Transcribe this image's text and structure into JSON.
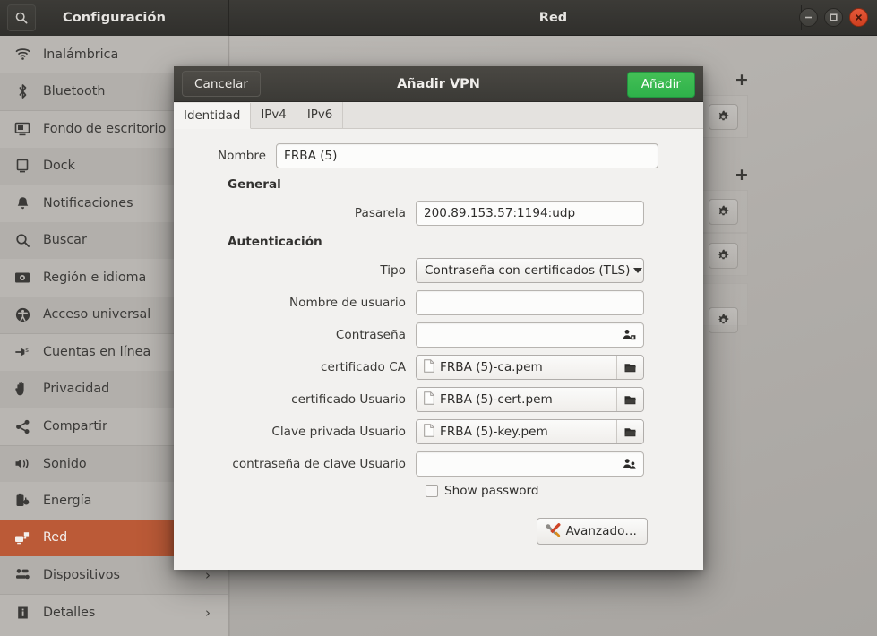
{
  "window": {
    "sidebar_title": "Configuración",
    "content_title": "Red",
    "search_icon": "search-icon",
    "controls": {
      "minimize": "minimize-icon",
      "maximize": "maximize-icon",
      "close": "close-icon"
    }
  },
  "sidebar": {
    "items": [
      {
        "label": "Inalámbrica",
        "icon": "wifi-icon"
      },
      {
        "label": "Bluetooth",
        "icon": "bluetooth-icon"
      },
      {
        "label": "Fondo de escritorio",
        "icon": "desktop-background-icon"
      },
      {
        "label": "Dock",
        "icon": "dock-icon"
      },
      {
        "label": "Notificaciones",
        "icon": "bell-icon"
      },
      {
        "label": "Buscar",
        "icon": "search-icon"
      },
      {
        "label": "Región e idioma",
        "icon": "region-language-icon"
      },
      {
        "label": "Acceso universal",
        "icon": "accessibility-icon"
      },
      {
        "label": "Cuentas en línea",
        "icon": "online-accounts-icon"
      },
      {
        "label": "Privacidad",
        "icon": "hand-privacy-icon"
      },
      {
        "label": "Compartir",
        "icon": "share-icon"
      },
      {
        "label": "Sonido",
        "icon": "sound-icon"
      },
      {
        "label": "Energía",
        "icon": "power-battery-icon"
      },
      {
        "label": "Red",
        "icon": "network-icon",
        "selected": true
      },
      {
        "label": "Dispositivos",
        "icon": "devices-icon",
        "arrow": "›"
      },
      {
        "label": "Detalles",
        "icon": "info-icon",
        "arrow": "›"
      }
    ]
  },
  "content": {
    "add_symbol": "+",
    "gear_icon": "gear-icon"
  },
  "dialog": {
    "title": "Añadir VPN",
    "cancel_label": "Cancelar",
    "add_label": "Añadir",
    "tabs": [
      {
        "label": "Identidad",
        "active": true
      },
      {
        "label": "IPv4",
        "active": false
      },
      {
        "label": "IPv6",
        "active": false
      }
    ],
    "fields": {
      "name_label": "Nombre",
      "name_value": "FRBA (5)",
      "general_heading": "General",
      "gateway_label": "Pasarela",
      "gateway_value": "200.89.153.57:1194:udp",
      "auth_heading": "Autenticación",
      "type_label": "Tipo",
      "type_value": "Contraseña con certificados (TLS)",
      "username_label": "Nombre de usuario",
      "username_value": "",
      "password_label": "Contraseña",
      "password_value": "",
      "ca_cert_label": "certificado CA",
      "ca_cert_value": "FRBA (5)-ca.pem",
      "user_cert_label": "certificado Usuario",
      "user_cert_value": "FRBA (5)-cert.pem",
      "user_key_label": "Clave privada Usuario",
      "user_key_value": "FRBA (5)-key.pem",
      "user_key_pass_label": "contraseña de clave Usuario",
      "user_key_pass_value": "",
      "show_password_label": "Show password",
      "advanced_label": "Avanzado…"
    }
  },
  "colors": {
    "selected_sidebar": "#bb5a37",
    "add_button_green": "#2eb14a",
    "close_button_red": "#cf3f1f",
    "dialog_bg": "#f2f1ef",
    "titlebar": "#3b3a36"
  }
}
